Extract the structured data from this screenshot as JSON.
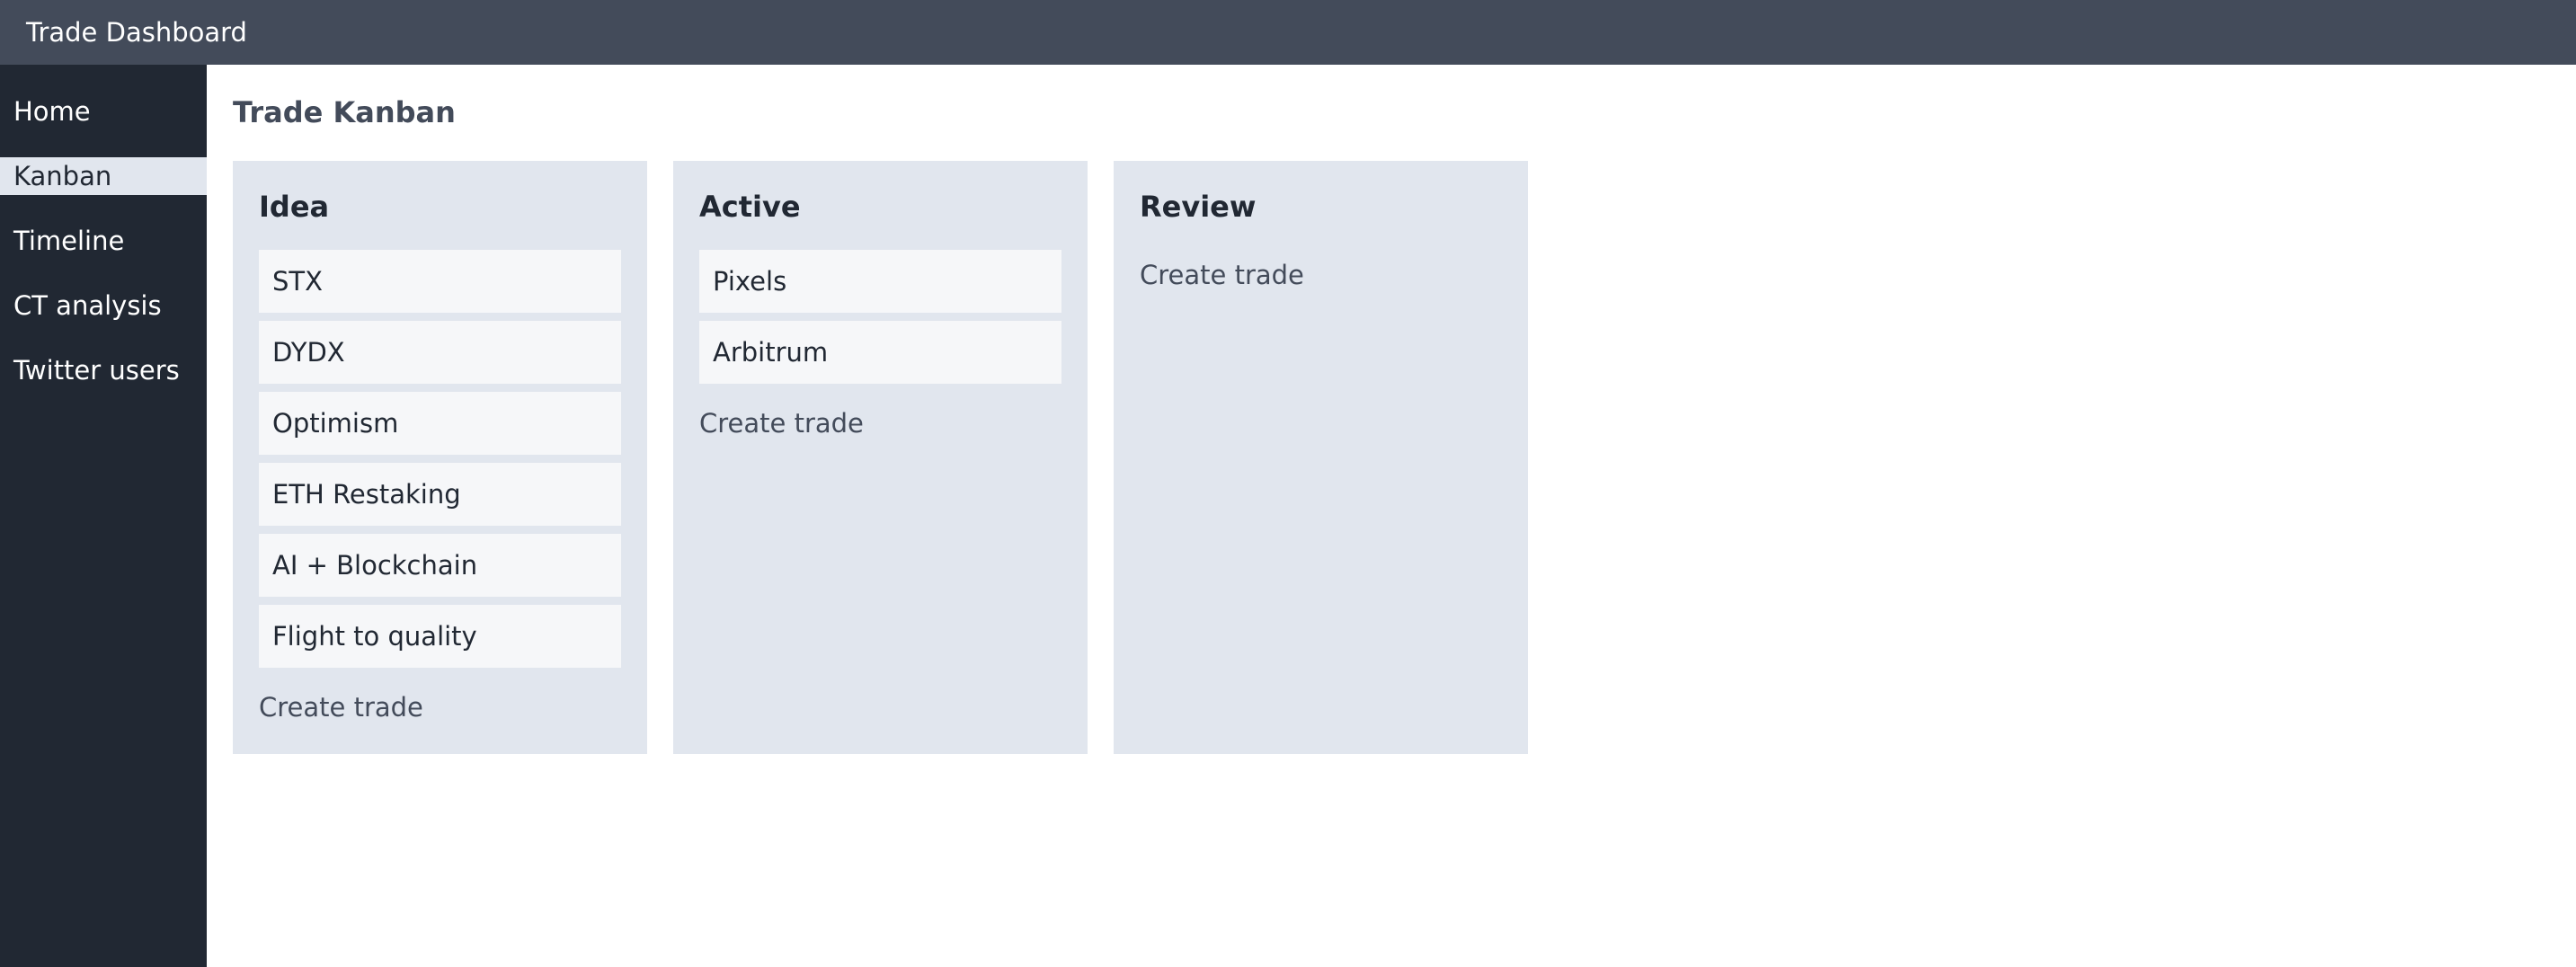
{
  "app": {
    "title": "Trade Dashboard"
  },
  "sidebar": {
    "items": [
      {
        "label": "Home"
      },
      {
        "label": "Kanban"
      },
      {
        "label": "Timeline"
      },
      {
        "label": "CT analysis"
      },
      {
        "label": "Twitter users"
      }
    ],
    "active": "Kanban"
  },
  "main": {
    "title": "Trade Kanban",
    "columns": [
      {
        "title": "Idea",
        "cards": [
          "STX",
          "DYDX",
          "Optimism",
          "ETH Restaking",
          "AI + Blockchain",
          "Flight to quality"
        ],
        "create_label": "Create trade"
      },
      {
        "title": "Active",
        "cards": [
          "Pixels",
          "Arbitrum"
        ],
        "create_label": "Create trade"
      },
      {
        "title": "Review",
        "cards": [],
        "create_label": "Create trade"
      }
    ]
  },
  "colors": {
    "topbar": "#434b5a",
    "sidebar": "#212833",
    "sidebar_active": "#e1e6ee",
    "column_bg": "#e1e6ee",
    "card_bg": "#f6f7f9"
  }
}
